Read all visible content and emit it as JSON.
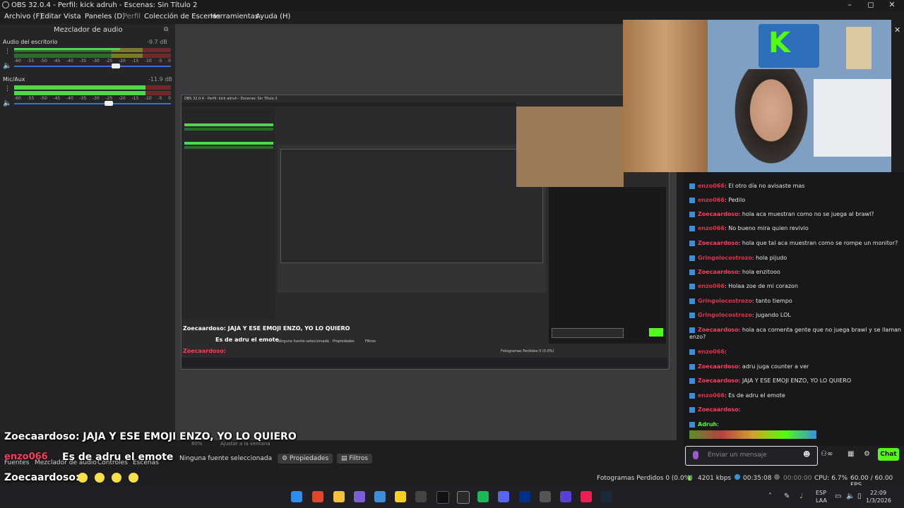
{
  "window": {
    "title": "OBS 32.0.4 - Perfil: kick adruh - Escenas: Sin Título 2",
    "minimize": "–",
    "maximize": "◻",
    "close": "✕"
  },
  "menu": [
    "Archivo (F)",
    "Editar",
    "Vista",
    "Paneles (D)",
    "Perfil",
    "Colección de Escenas",
    "Herramientas",
    "Ayuda (H)"
  ],
  "mixer": {
    "title": "Mezclador de audio",
    "channels": [
      {
        "name": "Audio del escritorio",
        "db": "-9.7 dB",
        "level": 0.68
      },
      {
        "name": "Mic/Aux",
        "db": "-11.9 dB",
        "level": 0.62
      }
    ],
    "scale": [
      "-60",
      "-55",
      "-50",
      "-45",
      "-40",
      "-35",
      "-30",
      "-25",
      "-20",
      "-15",
      "-10",
      "-5",
      "0"
    ]
  },
  "nested_obs": {
    "title": "OBS 32.0.4 - Perfil: kick adruh - Escenas: Sin Título 2",
    "overlay_msg": "Zoecaardoso: JAJA Y ESE EMOJI ENZO, YO LO QUIERO",
    "overlay_msg2": "Es de adru el emote",
    "overlay_user3": "Zoecaardoso:",
    "no_source": "Ninguna fuente seleccionada",
    "props": "Propiedades",
    "filters": "Filtros",
    "frames": "Fotogramas Perdidos 0 (0.0%)"
  },
  "chat": {
    "messages": [
      {
        "user": "enzo066",
        "text": ": El otro día no avisaste mas",
        "color": "#e0304a"
      },
      {
        "user": "enzo066",
        "text": ": Pedilo",
        "color": "#e0304a"
      },
      {
        "user": "Zoecaardoso",
        "text": ": hola aca muestran como no se juega al brawl?",
        "color": "#ff3b5c"
      },
      {
        "user": "enzo066",
        "text": ": No bueno mira quien revivio",
        "color": "#e0304a"
      },
      {
        "user": "Zoecaardoso",
        "text": ": hola que tal aca muestran como se rompe un monitor?",
        "color": "#ff3b5c"
      },
      {
        "user": "Gringolocostrozo",
        "text": ": hola pijudo",
        "color": "#e0304a"
      },
      {
        "user": "Zoecaardoso",
        "text": ": hola enzitooo",
        "color": "#ff3b5c"
      },
      {
        "user": "enzo066",
        "text": ": Holaa zoe de mi corazon",
        "color": "#e0304a"
      },
      {
        "user": "Gringolocostrozo",
        "text": ": tanto tiempo",
        "color": "#e0304a"
      },
      {
        "user": "Gringolocostrozo",
        "text": ": jugando LOL",
        "color": "#e0304a"
      },
      {
        "user": "Zoecaardoso",
        "text": ": hola aca comenta gente que no juega brawl y se llaman",
        "color": "#ff3b5c"
      },
      {
        "user": "",
        "text": "enzo?",
        "color": "#ff3b5c"
      },
      {
        "user": "enzo066",
        "text": ":",
        "color": "#e0304a"
      },
      {
        "user": "Zoecaardoso",
        "text": ": adru juga counter a ver",
        "color": "#ff3b5c"
      },
      {
        "user": "Zoecaardoso",
        "text": ": JAJA Y ESE EMOJI ENZO, YO LO QUIERO",
        "color": "#ff3b5c"
      },
      {
        "user": "enzo066",
        "text": ": Es de adru el emote",
        "color": "#e0304a"
      },
      {
        "user": "Zoecaardoso",
        "text": ":",
        "color": "#ff3b5c"
      },
      {
        "user": "Adruh",
        "text": ":",
        "color": "#53fc18"
      }
    ],
    "input_placeholder": "Enviar un mensaje",
    "chat_button": "Chat"
  },
  "overlay": {
    "line1": "Zoecaardoso: JAJA Y ESE EMOJI ENZO, YO LO QUIERO",
    "line2_user": "enzo066",
    "line2_text": "Es de adru el emote",
    "line3": "Zoecaardoso:"
  },
  "docks": {
    "tabs": [
      "Fuentes",
      "Mezclador de audio",
      "Controles",
      "Escenas"
    ],
    "zoom": "80%",
    "fit": "Ajustar a la ventana"
  },
  "properties_bar": {
    "no_source": "Ninguna fuente seleccionada",
    "props": "Propiedades",
    "filters": "Filtros"
  },
  "status": {
    "frames_lost": "Fotogramas Perdidos 0 (0.0%)",
    "bitrate": "4201 kbps",
    "stream_time": "00:35:08",
    "rec_time": "00:00:00",
    "cpu": "CPU: 6.7%",
    "fps": "60.00 / 60.00 FPS"
  },
  "taskbar": {
    "lang1": "ESP",
    "lang2": "LAA",
    "time": "22:09",
    "date": "1/3/2026"
  },
  "colors": {
    "kick_green": "#53fc18",
    "accent": "#53fc18"
  }
}
